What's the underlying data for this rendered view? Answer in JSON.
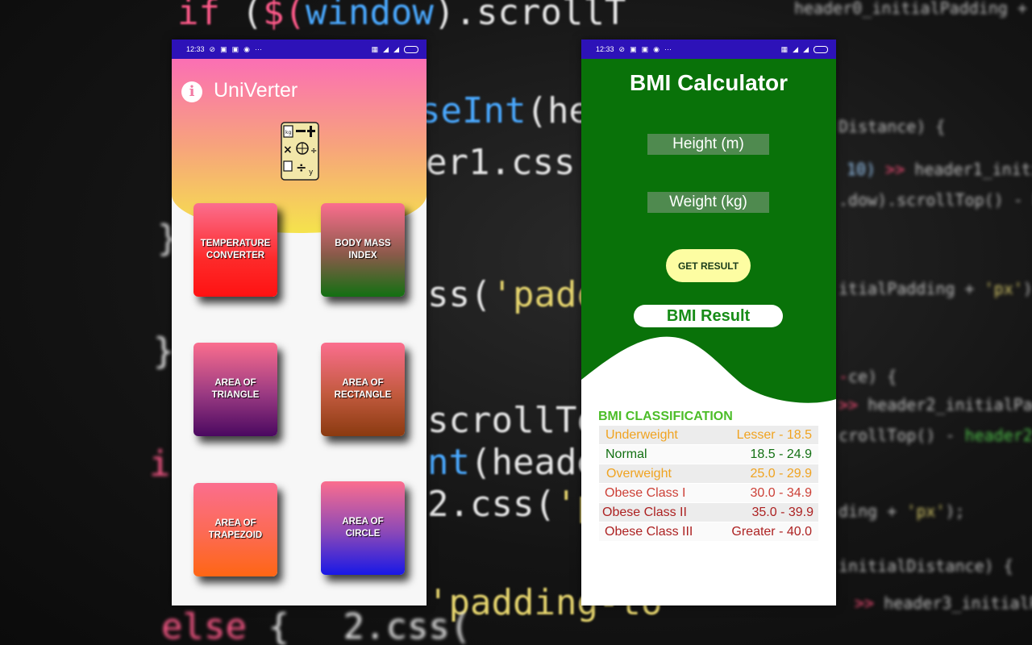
{
  "left_app": {
    "status": {
      "time": "12:33",
      "more": "···"
    },
    "title": "UniVerter",
    "tiles": [
      {
        "label1": "TEMPERATURE",
        "label2": "CONVERTER"
      },
      {
        "label1": "BODY MASS",
        "label2": "INDEX"
      },
      {
        "label1": "AREA OF",
        "label2": "TRIANGLE"
      },
      {
        "label1": "AREA OF",
        "label2": "RECTANGLE"
      },
      {
        "label1": "AREA OF",
        "label2": "TRAPEZOID"
      },
      {
        "label1": "AREA OF",
        "label2": "CIRCLE"
      }
    ]
  },
  "right_app": {
    "status": {
      "time": "12:33",
      "more": "···"
    },
    "title": "BMI Calculator",
    "height_placeholder": "Height (m)",
    "weight_placeholder": "Weight (kg)",
    "button_label": "GET RESULT",
    "result_label": "BMI Result",
    "classification_title": "BMI CLASSIFICATION",
    "classification": [
      {
        "category": "Underweight",
        "range": "Lesser - 18.5"
      },
      {
        "category": "Normal",
        "range": "18.5 - 24.9"
      },
      {
        "category": "Overweight",
        "range": "25.0 - 29.9"
      },
      {
        "category": "Obese Class I",
        "range": "30.0 - 34.9"
      },
      {
        "category": "Obese Class II",
        "range": "35.0 - 39.9"
      },
      {
        "category": "Obese Class III",
        "range": "Greater - 40.0"
      }
    ]
  },
  "background_code": [
    {
      "kw": "if",
      "rest": " ($(window).scrollT"
    },
    {
      "kw": "",
      "rest": "ParseInt(header"
    },
    {
      "kw": "",
      "rest": "header1.css('p"
    },
    {
      "kw": "",
      "rest": ".css('paddin"
    },
    {
      "kw": "",
      "rest": ".scrollTop(/"
    },
    {
      "kw": "",
      "rest": "int(header2."
    },
    {
      "kw": "",
      "rest": "r2.css('padd"
    },
    {
      "kw": "else",
      "rest": " { .css('padding-to"
    }
  ],
  "colors": {
    "status_bar": "#2d12b8",
    "bmi_green": "#097209",
    "header_pink": "#fb6fb4",
    "header_yellow": "#f5e34c",
    "class_orange": "#f0a320",
    "class_green": "#137013",
    "class_red": "#cc3f36",
    "class_darkred": "#ad2222"
  },
  "icons": [
    "info-icon",
    "app-logo-icon",
    "wifi-icon",
    "signal-icon",
    "battery-icon"
  ]
}
